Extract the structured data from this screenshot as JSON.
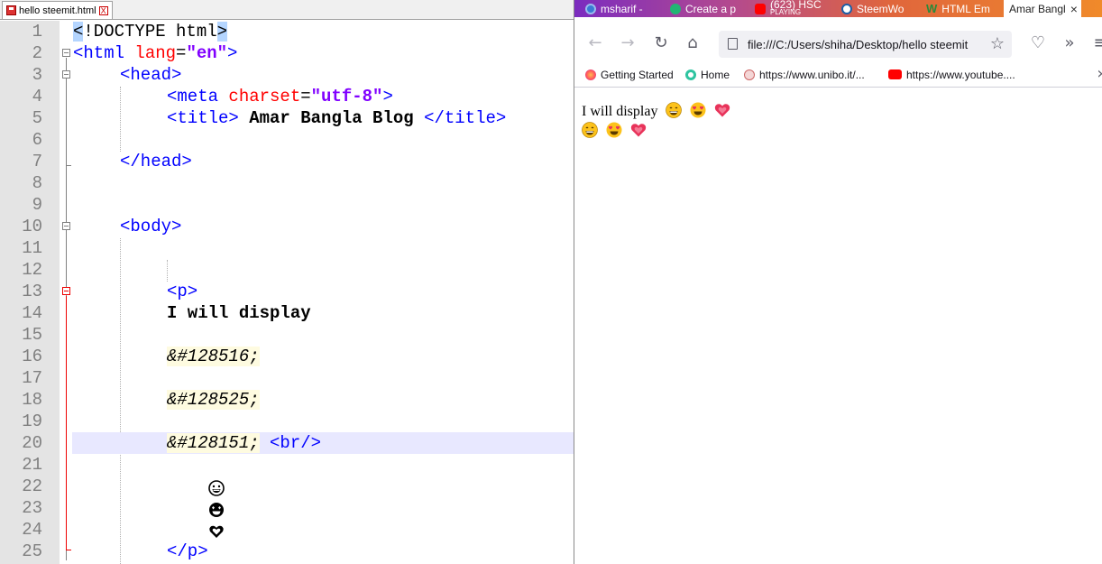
{
  "editor": {
    "tab_title": "hello steemit.html",
    "tab_close": "X",
    "line_numbers": [
      "1",
      "2",
      "3",
      "4",
      "5",
      "6",
      "7",
      "8",
      "9",
      "10",
      "11",
      "12",
      "13",
      "14",
      "15",
      "16",
      "17",
      "18",
      "19",
      "20",
      "21",
      "22",
      "23",
      "24",
      "25"
    ],
    "lines": {
      "l1_open": "<",
      "l1_mid": "!DOCTYPE html",
      "l1_close": ">",
      "l2_tag": "<html",
      "l2_attr": " lang",
      "l2_eq": "=",
      "l2_val": "\"en\"",
      "l2_end": ">",
      "l3": "<head>",
      "l4_tag": "<meta",
      "l4_attr": " charset",
      "l4_eq": "=",
      "l4_val": "\"utf-8\"",
      "l4_end": ">",
      "l5_open": "<title>",
      "l5_text": " Amar Bangla Blog ",
      "l5_close": "</title>",
      "l7": "</head>",
      "l10": "<body>",
      "l13": "<p>",
      "l14": "I will display",
      "l16": "&#128516;",
      "l18": "&#128525;",
      "l20_ent": "&#128151;",
      "l20_br": " <br/>",
      "l25": "</p>"
    }
  },
  "browser": {
    "tabs": [
      {
        "label": "msharif -",
        "sub": ""
      },
      {
        "label": "Create a p",
        "sub": ""
      },
      {
        "label": "(623) HSC",
        "sub": "PLAYING"
      },
      {
        "label": "SteemWo",
        "sub": ""
      },
      {
        "label": "HTML Em",
        "sub": ""
      },
      {
        "label": "Amar Bangl",
        "sub": ""
      }
    ],
    "active_tab_close": "×",
    "url": "file:///C:/Users/shiha/Desktop/hello steemit",
    "bookmarks": [
      "Getting Started",
      "Home",
      "https://www.unibo.it/...",
      "https://www.youtube...."
    ],
    "page_text": "I will display"
  },
  "colors": {
    "tag": "#0000ff",
    "attribute": "#ff0000",
    "value": "#8000ff",
    "current_line": "#e8e8ff",
    "emoji_yellow": "#fcc21b",
    "heart_pink": "#e8335a"
  },
  "icons": [
    "save-icon",
    "close-icon",
    "back-arrow-icon",
    "forward-arrow-icon",
    "reload-icon",
    "home-icon",
    "page-icon",
    "star-icon",
    "pocket-icon",
    "overflow-chevron-icon",
    "menu-icon",
    "grinning-face-emoji",
    "heart-eyes-emoji",
    "growing-heart-emoji"
  ]
}
